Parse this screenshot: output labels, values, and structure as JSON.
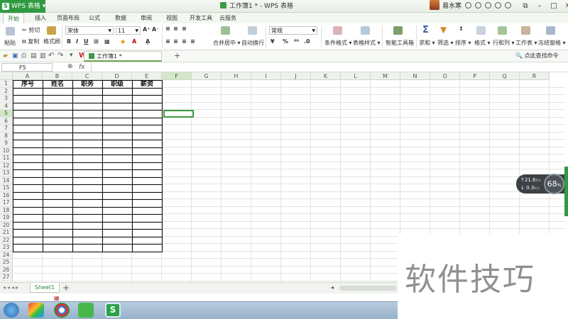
{
  "app": {
    "name": "WPS 表格",
    "window_title": "工作簿1 * - WPS 表格",
    "username": "易水寒"
  },
  "tabs": [
    "开始",
    "插入",
    "页面布局",
    "公式",
    "数据",
    "审阅",
    "视图",
    "开发工具",
    "云服务"
  ],
  "active_tab": "开始",
  "ribbon": {
    "cut": "剪切",
    "copy": "复制",
    "paste": "粘贴",
    "format_painter": "格式刷",
    "font_name": "宋体",
    "font_size": "11",
    "bold": "B",
    "italic": "I",
    "underline": "U",
    "merge_center": "合并居中",
    "wrap_text": "自动换行",
    "number_format": "常规",
    "conditional_format": "条件格式",
    "table_style": "表格样式",
    "smart_toolbox": "智能工具箱",
    "sum": "求和",
    "filter": "筛选",
    "sort": "排序",
    "format": "格式",
    "row_col": "行和列",
    "worksheet": "工作表",
    "freeze": "冻结窗格"
  },
  "doc_tab": "工作簿1 *",
  "find_command": "点此查找命令",
  "name_box": "F5",
  "fx_label": "fx",
  "columns": [
    "A",
    "B",
    "C",
    "D",
    "E",
    "F",
    "G",
    "H",
    "I",
    "J",
    "K",
    "L",
    "M",
    "N",
    "O",
    "P",
    "Q",
    "R"
  ],
  "rows": [
    "1",
    "2",
    "3",
    "4",
    "5",
    "6",
    "7",
    "8",
    "9",
    "10",
    "11",
    "12",
    "13",
    "14",
    "15",
    "16",
    "17",
    "18",
    "19",
    "20",
    "21",
    "22",
    "23",
    "24",
    "25",
    "26",
    "27"
  ],
  "table_headers": [
    "序号",
    "姓名",
    "职务",
    "职级",
    "薪资"
  ],
  "sheet_tab": "Sheet1",
  "net_widget": {
    "up": "21.6",
    "down": "0.3",
    "unit": "K/s",
    "percent": "68",
    "percent_suffix": "%"
  },
  "watermark": "软件技巧",
  "colors": {
    "accent": "#2f9a3f",
    "selection": "#3c9a3f"
  }
}
